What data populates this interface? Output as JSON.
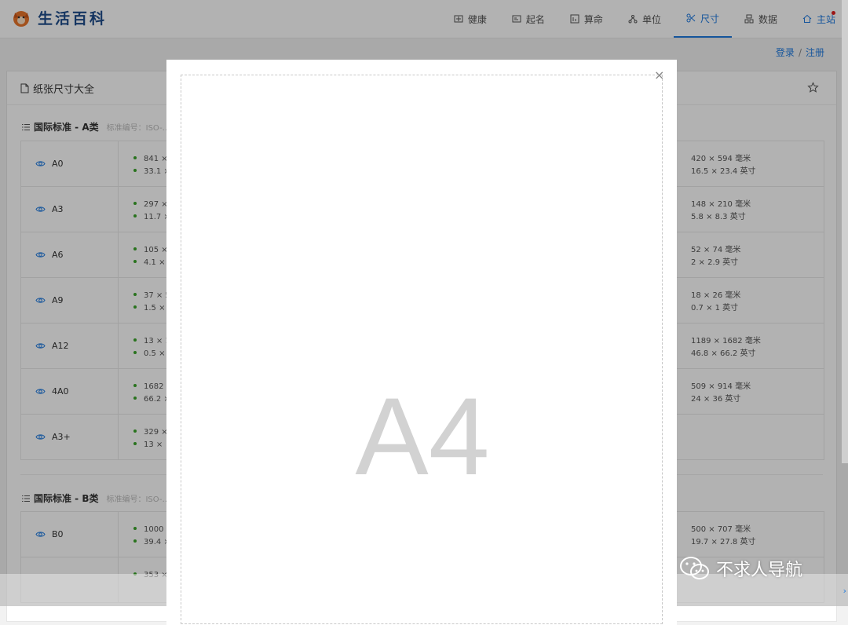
{
  "brand": {
    "name": "生活百科"
  },
  "nav": [
    {
      "label": "健康",
      "icon": "health-icon"
    },
    {
      "label": "起名",
      "icon": "naming-icon"
    },
    {
      "label": "算命",
      "icon": "fortune-icon"
    },
    {
      "label": "单位",
      "icon": "unit-icon"
    },
    {
      "label": "尺寸",
      "icon": "scissors-icon",
      "active": true
    },
    {
      "label": "数据",
      "icon": "data-icon"
    },
    {
      "label": "主站",
      "icon": "home-icon"
    }
  ],
  "auth": {
    "login": "登录",
    "separator": "/",
    "register": "注册"
  },
  "panel": {
    "title": "纸张尺寸大全"
  },
  "sections": [
    {
      "title": "国际标准 - A类",
      "note": "标准编号：ISO-…",
      "rows": [
        {
          "name": "A0",
          "left1": "841 ×",
          "left2": "33.1 ×",
          "right1": "420 × 594 毫米",
          "right2": "16.5 × 23.4 英寸"
        },
        {
          "name": "A3",
          "left1": "297 ×",
          "left2": "11.7 ×",
          "right1": "148 × 210 毫米",
          "right2": "5.8 × 8.3 英寸"
        },
        {
          "name": "A6",
          "left1": "105 ×",
          "left2": "4.1 ×",
          "right1": "52 × 74 毫米",
          "right2": "2 × 2.9 英寸"
        },
        {
          "name": "A9",
          "left1": "37 × 5",
          "left2": "1.5 ×",
          "right1": "18 × 26 毫米",
          "right2": "0.7 × 1 英寸"
        },
        {
          "name": "A12",
          "left1": "13 × 1",
          "left2": "0.5 ×",
          "right1": "1189 × 1682 毫米",
          "right2": "46.8 × 66.2 英寸"
        },
        {
          "name": "4A0",
          "left1": "1682 ×",
          "left2": "66.2 ×",
          "right1": "509 × 914 毫米",
          "right2": "24 × 36 英寸"
        },
        {
          "name": "A3+",
          "left1": "329 ×",
          "left2": "13 ×",
          "right1": "",
          "right2": ""
        }
      ]
    },
    {
      "title": "国际标准 - B类",
      "note": "标准编号：ISO-…",
      "rows": [
        {
          "name": "B0",
          "left1": "1000 ×",
          "left2": "39.4 ×",
          "right1": "500 × 707 毫米",
          "right2": "19.7 × 27.8 英寸"
        },
        {
          "name": "",
          "left1": "353 ×",
          "left2": "",
          "right1": "",
          "right2": ""
        }
      ]
    }
  ],
  "modal": {
    "close": "×",
    "paper_label": "A4"
  },
  "watermark": {
    "text": "不求人导航"
  },
  "side_arrow": "›"
}
